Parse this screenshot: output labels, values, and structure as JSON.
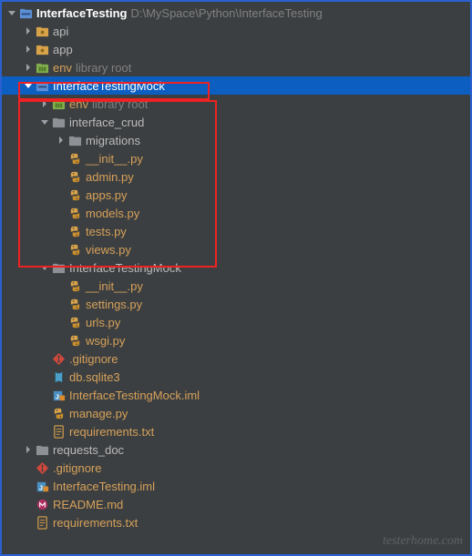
{
  "watermark": "testerhome.com",
  "nodes": [
    {
      "depth": 0,
      "arrow": "down",
      "icon": "proj",
      "text": "InterfaceTesting",
      "color": "white",
      "extra": "D:\\MySpace\\Python\\InterfaceTesting",
      "selected": false
    },
    {
      "depth": 1,
      "arrow": "right",
      "icon": "pkg-y",
      "text": "api",
      "color": "normal"
    },
    {
      "depth": 1,
      "arrow": "right",
      "icon": "pkg-y",
      "text": "app",
      "color": "normal"
    },
    {
      "depth": 1,
      "arrow": "right",
      "icon": "lib",
      "text": "env",
      "color": "yellow",
      "extra": "library root"
    },
    {
      "depth": 1,
      "arrow": "down",
      "icon": "proj",
      "text": "InterfaceTestingMock",
      "color": "white",
      "selected": true
    },
    {
      "depth": 2,
      "arrow": "right",
      "icon": "lib",
      "text": "env",
      "color": "yellow",
      "extra": "library root"
    },
    {
      "depth": 2,
      "arrow": "down",
      "icon": "folder",
      "text": "interface_crud",
      "color": "normal"
    },
    {
      "depth": 3,
      "arrow": "right",
      "icon": "folder",
      "text": "migrations",
      "color": "normal"
    },
    {
      "depth": 3,
      "arrow": "none",
      "icon": "py",
      "text": "__init__.py",
      "color": "yellow"
    },
    {
      "depth": 3,
      "arrow": "none",
      "icon": "py",
      "text": "admin.py",
      "color": "yellow"
    },
    {
      "depth": 3,
      "arrow": "none",
      "icon": "py",
      "text": "apps.py",
      "color": "yellow"
    },
    {
      "depth": 3,
      "arrow": "none",
      "icon": "py",
      "text": "models.py",
      "color": "yellow"
    },
    {
      "depth": 3,
      "arrow": "none",
      "icon": "py",
      "text": "tests.py",
      "color": "yellow"
    },
    {
      "depth": 3,
      "arrow": "none",
      "icon": "py",
      "text": "views.py",
      "color": "yellow"
    },
    {
      "depth": 2,
      "arrow": "down",
      "icon": "folder",
      "text": "InterfaceTestingMock",
      "color": "normal"
    },
    {
      "depth": 3,
      "arrow": "none",
      "icon": "py",
      "text": "__init__.py",
      "color": "yellow"
    },
    {
      "depth": 3,
      "arrow": "none",
      "icon": "py",
      "text": "settings.py",
      "color": "yellow"
    },
    {
      "depth": 3,
      "arrow": "none",
      "icon": "py",
      "text": "urls.py",
      "color": "yellow"
    },
    {
      "depth": 3,
      "arrow": "none",
      "icon": "py",
      "text": "wsgi.py",
      "color": "yellow"
    },
    {
      "depth": 2,
      "arrow": "none",
      "icon": "git",
      "text": ".gitignore",
      "color": "yellow"
    },
    {
      "depth": 2,
      "arrow": "none",
      "icon": "db",
      "text": "db.sqlite3",
      "color": "yellow"
    },
    {
      "depth": 2,
      "arrow": "none",
      "icon": "iml",
      "text": "InterfaceTestingMock.iml",
      "color": "yellow"
    },
    {
      "depth": 2,
      "arrow": "none",
      "icon": "py",
      "text": "manage.py",
      "color": "yellow"
    },
    {
      "depth": 2,
      "arrow": "none",
      "icon": "txt",
      "text": "requirements.txt",
      "color": "yellow"
    },
    {
      "depth": 1,
      "arrow": "right",
      "icon": "folder",
      "text": "requests_doc",
      "color": "normal"
    },
    {
      "depth": 1,
      "arrow": "none",
      "icon": "git",
      "text": ".gitignore",
      "color": "yellow"
    },
    {
      "depth": 1,
      "arrow": "none",
      "icon": "iml",
      "text": "InterfaceTesting.iml",
      "color": "yellow"
    },
    {
      "depth": 1,
      "arrow": "none",
      "icon": "md",
      "text": "README.md",
      "color": "yellow"
    },
    {
      "depth": 1,
      "arrow": "none",
      "icon": "txt",
      "text": "requirements.txt",
      "color": "yellow"
    }
  ]
}
